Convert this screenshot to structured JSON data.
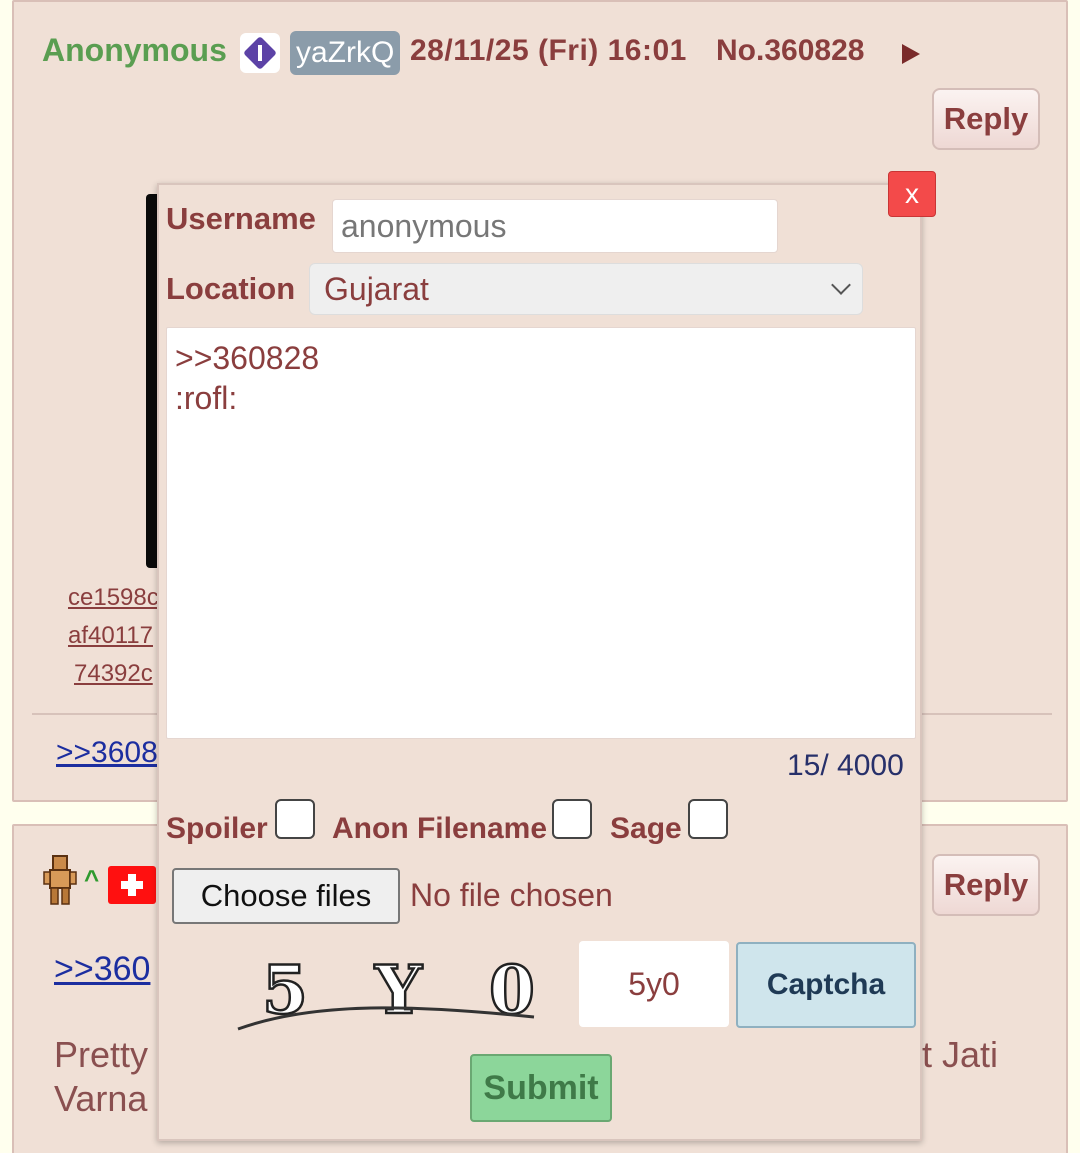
{
  "post1": {
    "name": "Anonymous",
    "poster_id": "yaZrkQ",
    "datetime": "28/11/25 (Fri) 16:01",
    "post_number": "No.360828",
    "reply_label": "Reply",
    "file_hashes": [
      "ce1598c",
      "af40117",
      "74392c"
    ],
    "backlink": ">>3608"
  },
  "post2": {
    "caret": "^",
    "reply_label": "Reply",
    "quote_link": ">>360",
    "body_line1": "Pretty",
    "body_line2": "Varna",
    "body_right": "t Jati"
  },
  "quick_reply": {
    "close_label": "x",
    "username_label": "Username",
    "username_value": "anonymous",
    "location_label": "Location",
    "location_value": "Gujarat",
    "comment": ">>360828\n:rofl:",
    "char_counter": "15/ 4000",
    "spoiler_label": "Spoiler",
    "anon_filename_label": "Anon Filename",
    "sage_label": "Sage",
    "choose_files_label": "Choose files",
    "no_file_text": "No file chosen",
    "captcha_image_text": "5 Y 0",
    "captcha_value": "5y0",
    "captcha_button": "Captcha",
    "submit_label": "Submit"
  },
  "colors": {
    "post_bg": "#f0e0d6",
    "name_green": "#5a9e51",
    "maroon_text": "#8a3e3e",
    "link_blue": "#1c2ea0",
    "close_red": "#f34a4a",
    "submit_green": "#8cd69a"
  }
}
